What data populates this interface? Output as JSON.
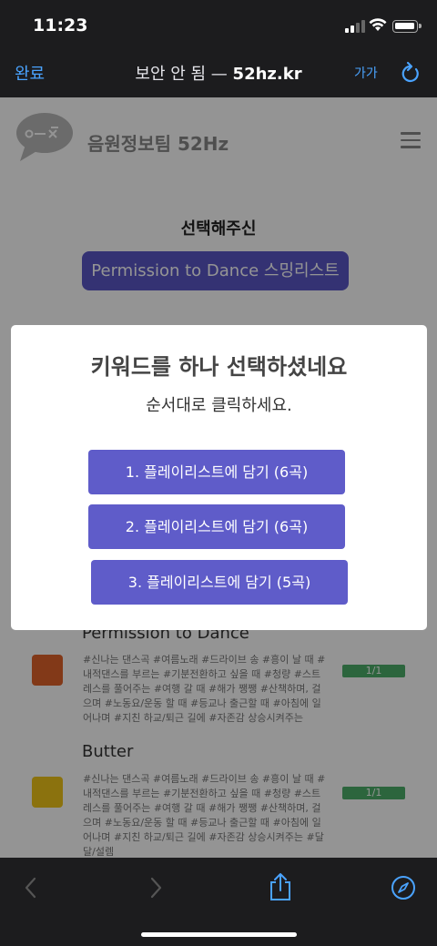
{
  "status_bar": {
    "time": "11:23"
  },
  "browser": {
    "done_label": "완료",
    "not_secure": "보안 안 됨 —",
    "host": "52hz.kr",
    "text_size": "가가",
    "reload_icon": "reload-icon"
  },
  "site": {
    "name": "음원정보팀 52Hz",
    "select_title": "선택해주신",
    "selected_keyword": "Permission to Dance 스밍리스트"
  },
  "modal": {
    "title": "키워드를 하나 선택하셨네요",
    "subtitle": "순서대로 클릭하세요.",
    "buttons": [
      "1. 플레이리스트에 담기 (6곡)",
      "2. 플레이리스트에 담기 (6곡)",
      "3. 플레이리스트에 담기 (5곡)"
    ]
  },
  "songs": [
    {
      "title": "Permission to Dance",
      "tags": "#신나는 댄스곡 #여름노래 #드라이브 송 #흥이 날 때 #내적댄스를 부르는 #기분전환하고 싶을 때 #청량 #스트레스를 풀어주는 #여행 갈 때 #해가 쨍쨍 #산책하며, 걸으며 #노동요/운동 할 때 #등교나 출근할 때 #아침에 일어나며 #지친 하교/퇴근 길에 #자존감 상승시켜주는",
      "count": "1/1",
      "album_color": "#e0622a"
    },
    {
      "title": "Butter",
      "tags": "#신나는 댄스곡 #여름노래 #드라이브 송 #흥이 날 때 #내적댄스를 부르는 #기분전환하고 싶을 때 #청량 #스트레스를 풀어주는 #여행 갈 때 #해가 쨍쨍 #산책하며, 걸으며 #노동요/운동 할 때 #등교나 출근할 때 #아침에 일어나며 #지친 하교/퇴근 길에 #자존감 상승시켜주는 #달달/설렘",
      "count": "1/1",
      "album_color": "#f0c419"
    }
  ],
  "colors": {
    "accent": "#5f5cc9",
    "ios_blue": "#4aa3ff",
    "count_green": "#4caf6a"
  }
}
